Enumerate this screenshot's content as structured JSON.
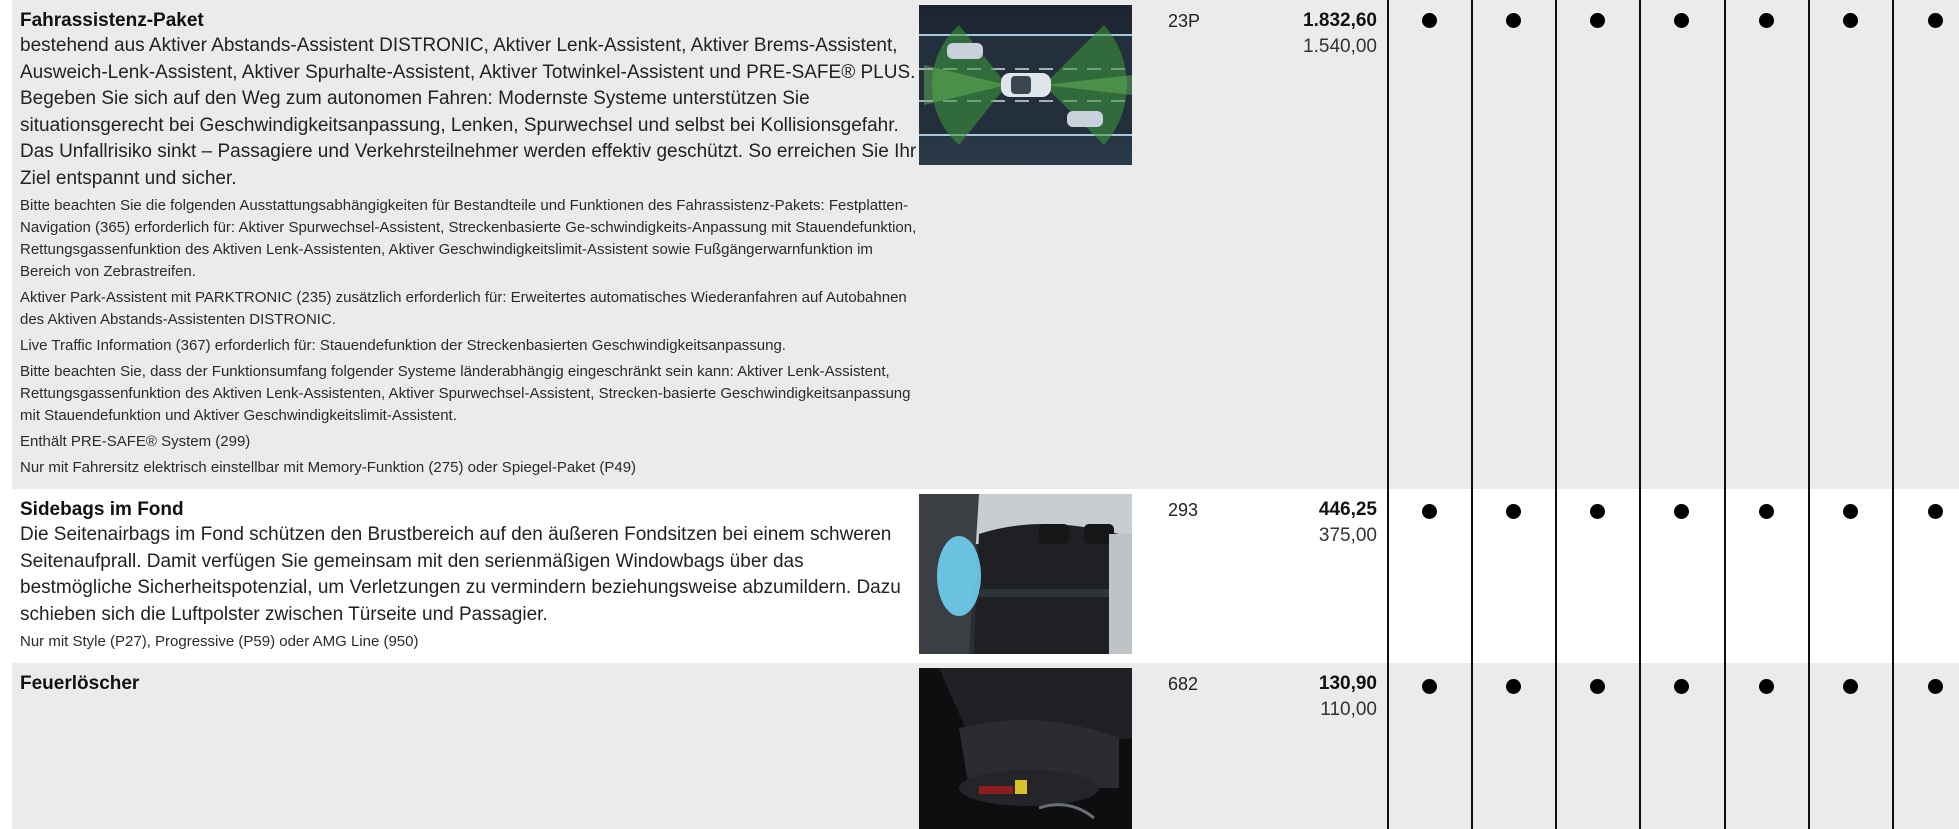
{
  "rows": [
    {
      "title": "Fahrassistenz-Paket",
      "body": "bestehend aus Aktiver Abstands-Assistent DISTRONIC, Aktiver Lenk-Assistent, Aktiver Brems-Assistent, Ausweich-Lenk-Assistent, Aktiver Spurhalte-Assistent, Aktiver Totwinkel-Assistent und PRE-SAFE® PLUS. Begeben Sie sich auf den Weg zum autonomen Fahren: Modernste Systeme unterstützen Sie situationsgerecht bei Geschwindigkeitsanpassung, Lenken, Spurwechsel und selbst bei Kollisionsgefahr. Das Unfallrisiko sinkt – Passagiere und Verkehrsteilnehmer werden effektiv geschützt. So erreichen Sie Ihr Ziel entspannt und sicher.",
      "notes": [
        "Bitte beachten Sie die folgenden Ausstattungsabhängigkeiten für Bestandteile und Funktionen des Fahrassistenz-Pakets: Festplatten-Navigation (365) erforderlich für: Aktiver Spurwechsel-Assistent, Streckenbasierte Ge-schwindigkeits-Anpassung mit Stauendefunktion, Rettungsgassenfunktion des Aktiven Lenk-Assistenten, Aktiver Geschwindigkeitslimit-Assistent sowie Fußgängerwarnfunktion im Bereich von Zebrastreifen.",
        "Aktiver Park-Assistent mit PARKTRONIC (235) zusätzlich erforderlich für: Erweitertes automatisches Wiederanfahren auf Autobahnen des Aktiven Abstands-Assistenten DISTRONIC.",
        "Live Traffic Information (367) erforderlich für: Stauendefunktion der Streckenbasierten Geschwindigkeitsanpassung.",
        "Bitte beachten Sie, dass der Funktionsumfang folgender Systeme länderabhängig eingeschränkt sein kann: Aktiver Lenk-Assistent, Rettungsgassenfunktion des Aktiven Lenk-Assistenten, Aktiver Spurwechsel-Assistent, Strecken-basierte Geschwindigkeitsanpassung mit Stauendefunktion und Aktiver Geschwindigkeitslimit-Assistent.",
        "Enthält PRE-SAFE® System (299)",
        "Nur mit Fahrersitz elektrisch einstellbar mit Memory-Funktion (275) oder Spiegel-Paket (P49)"
      ],
      "code": "23P",
      "price_gross": "1.832,60",
      "price_net": "1.540,00",
      "image": "driving-assistance-radar-graphic"
    },
    {
      "title": "Sidebags im Fond",
      "body": "Die Seitenairbags im Fond schützen den Brustbereich auf den äußeren Fondsitzen bei einem schweren Seitenaufprall. Damit verfügen Sie gemeinsam mit den serienmäßigen Windowbags über das bestmögliche Sicherheitspotenzial, um Verletzungen zu vermindern beziehungsweise abzumildern. Dazu schieben sich die Luftpolster zwischen Türseite und Passagier.",
      "notes": [
        "Nur mit Style (P27), Progressive (P59) oder AMG Line (950)"
      ],
      "code": "293",
      "price_gross": "446,25",
      "price_net": "375,00",
      "image": "rear-seat-sidebag-photo"
    },
    {
      "title": "Feuerlöscher",
      "body": "",
      "notes": [],
      "code": "682",
      "price_gross": "130,90",
      "price_net": "110,00",
      "image": "fire-extinguisher-under-seat-photo"
    }
  ],
  "availability_symbol": "●",
  "colors": {
    "grey_row": "#ebebeb",
    "white_row": "#ffffff",
    "divider": "#111111"
  }
}
